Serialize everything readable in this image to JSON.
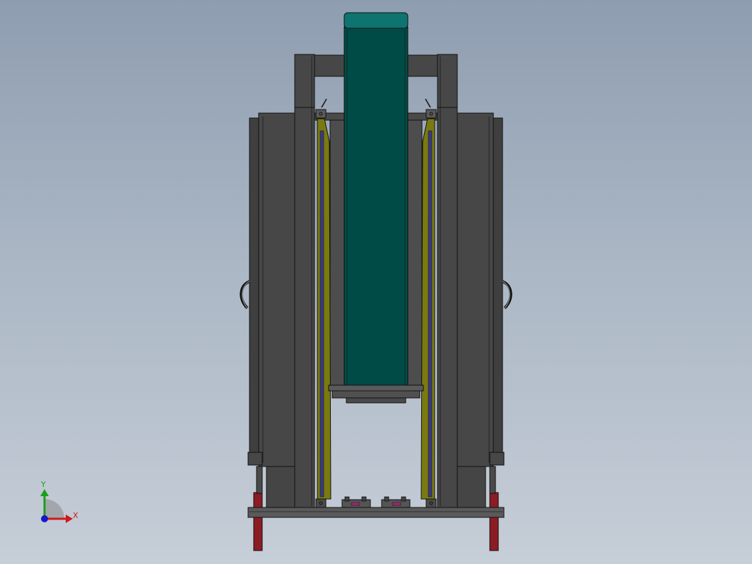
{
  "viewport": {
    "colors": {
      "frame": "#474747",
      "frame_dark": "#3a3a3a",
      "outline": "#111111",
      "column": "#004b45",
      "column_cap": "#0e7470",
      "rail": "#7a7a10",
      "rail_inner": "#3a3a80",
      "leg": "#8b1c24"
    }
  },
  "triad": {
    "x_label": "X",
    "y_label": "Y",
    "x_color": "#d01818",
    "y_color": "#18a018",
    "z_color": "#1818c8"
  }
}
